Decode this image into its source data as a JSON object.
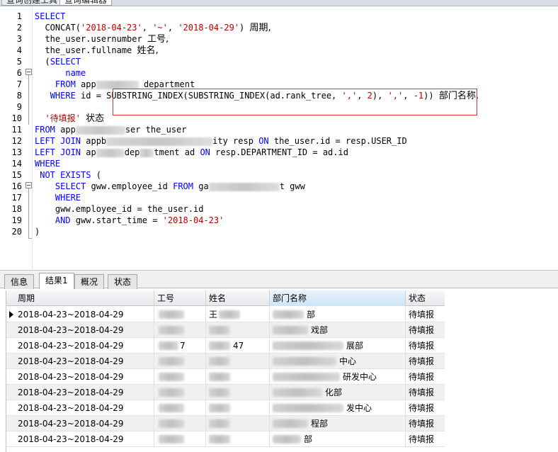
{
  "top_tabs": [
    "查询创建工具",
    "查询编辑器"
  ],
  "code": {
    "lines": [
      {
        "n": "1",
        "parts": [
          [
            "kw",
            "SELECT"
          ]
        ]
      },
      {
        "n": "2",
        "parts": [
          [
            "pl",
            "  CONCAT("
          ],
          [
            "str",
            "'2018-04-23'"
          ],
          [
            "pl",
            ", "
          ],
          [
            "str",
            "'~'"
          ],
          [
            "pl",
            ", "
          ],
          [
            "str",
            "'2018-04-29'"
          ],
          [
            "pl",
            ") "
          ],
          [
            "cjk",
            "周期,"
          ]
        ]
      },
      {
        "n": "3",
        "parts": [
          [
            "pl",
            "  the_user.usernumber "
          ],
          [
            "cjk",
            "工号,"
          ]
        ]
      },
      {
        "n": "4",
        "parts": [
          [
            "pl",
            "  the_user.fullname "
          ],
          [
            "cjk",
            "姓名,"
          ]
        ]
      },
      {
        "n": "5",
        "parts": [
          [
            "pl",
            "  ("
          ],
          [
            "kw",
            "SELECT"
          ]
        ]
      },
      {
        "n": "6",
        "parts": [
          [
            "pl",
            "      "
          ],
          [
            "kw",
            "name"
          ]
        ]
      },
      {
        "n": "7",
        "parts": [
          [
            "pl",
            "    "
          ],
          [
            "kw",
            "FROM"
          ],
          [
            "pl",
            " app"
          ],
          [
            "blur",
            "60"
          ],
          [
            "pl",
            " department"
          ]
        ]
      },
      {
        "n": "8",
        "parts": [
          [
            "pl",
            "   "
          ],
          [
            "kw",
            "WHERE"
          ],
          [
            "pl",
            " id = SUBSTRING_INDEX(SUBSTRING_INDEX(ad.rank_tree, "
          ],
          [
            "str",
            "','"
          ],
          [
            "pl",
            ", "
          ],
          [
            "num",
            "2"
          ],
          [
            "pl",
            "), "
          ],
          [
            "str",
            "','"
          ],
          [
            "pl",
            ", "
          ],
          [
            "num",
            "-1"
          ],
          [
            "pl",
            ")) "
          ],
          [
            "cjk",
            "部门名称,"
          ]
        ]
      },
      {
        "n": "9",
        "parts": []
      },
      {
        "n": "10",
        "parts": [
          [
            "pl",
            "  "
          ],
          [
            "str",
            "'待填报'"
          ],
          [
            "pl",
            " "
          ],
          [
            "cjk",
            "状态"
          ]
        ]
      },
      {
        "n": "11",
        "parts": [
          [
            "kw",
            "FROM"
          ],
          [
            "pl",
            " app"
          ],
          [
            "blur",
            "70"
          ],
          [
            "pl",
            "ser the_user"
          ]
        ]
      },
      {
        "n": "12",
        "parts": [
          [
            "kw",
            "LEFT JOIN"
          ],
          [
            "pl",
            " appb"
          ],
          [
            "blur",
            "150"
          ],
          [
            "pl",
            "ity resp "
          ],
          [
            "kw",
            "ON"
          ],
          [
            "pl",
            " the_user.id = resp.USER_ID"
          ]
        ]
      },
      {
        "n": "13",
        "parts": [
          [
            "kw",
            "LEFT JOIN"
          ],
          [
            "pl",
            " ap"
          ],
          [
            "blur",
            "40"
          ],
          [
            "pl",
            "dep"
          ],
          [
            "blur",
            "20"
          ],
          [
            "pl",
            "tment ad "
          ],
          [
            "kw",
            "ON"
          ],
          [
            "pl",
            " resp.DEPARTMENT_ID = ad.id"
          ]
        ]
      },
      {
        "n": "14",
        "parts": [
          [
            "kw",
            "WHERE"
          ]
        ]
      },
      {
        "n": "15",
        "parts": [
          [
            "pl",
            " "
          ],
          [
            "kw",
            "NOT EXISTS"
          ],
          [
            "pl",
            " ("
          ]
        ]
      },
      {
        "n": "16",
        "parts": [
          [
            "pl",
            "    "
          ],
          [
            "kw",
            "SELECT"
          ],
          [
            "pl",
            " gww.employee_id "
          ],
          [
            "kw",
            "FROM"
          ],
          [
            "pl",
            " ga"
          ],
          [
            "blur",
            "100"
          ],
          [
            "pl",
            "t gww"
          ]
        ]
      },
      {
        "n": "17",
        "parts": [
          [
            "pl",
            "    "
          ],
          [
            "kw",
            "WHERE"
          ]
        ]
      },
      {
        "n": "18",
        "parts": [
          [
            "pl",
            "    gww.employee_id = the_user.id"
          ]
        ]
      },
      {
        "n": "19",
        "parts": [
          [
            "pl",
            "    "
          ],
          [
            "kw",
            "AND"
          ],
          [
            "pl",
            " gww.start_time = "
          ],
          [
            "str",
            "'2018-04-23'"
          ]
        ]
      },
      {
        "n": "20",
        "parts": [
          [
            "pl",
            ")"
          ]
        ]
      }
    ]
  },
  "result_tabs": [
    "信息",
    "结果1",
    "概况",
    "状态"
  ],
  "grid": {
    "headers": [
      "周期",
      "工号",
      "姓名",
      "部门名称",
      "状态"
    ],
    "rows": [
      {
        "period": "2018-04-23~2018-04-29",
        "num_vis": "",
        "name_vis": "王",
        "dept_vis": "部",
        "status": "待填报"
      },
      {
        "period": "2018-04-23~2018-04-29",
        "num_vis": "",
        "name_vis": "",
        "dept_vis": "戏部",
        "status": "待填报"
      },
      {
        "period": "2018-04-23~2018-04-29",
        "num_vis": "7",
        "name_vis": "47",
        "dept_vis": "展部",
        "status": "待填报"
      },
      {
        "period": "2018-04-23~2018-04-29",
        "num_vis": "",
        "name_vis": "",
        "dept_vis": "中心",
        "status": "待填报"
      },
      {
        "period": "2018-04-23~2018-04-29",
        "num_vis": "",
        "name_vis": "",
        "dept_vis": "研发中心",
        "status": "待填报"
      },
      {
        "period": "2018-04-23~2018-04-29",
        "num_vis": "",
        "name_vis": "",
        "dept_vis": "化部",
        "status": "待填报"
      },
      {
        "period": "2018-04-23~2018-04-29",
        "num_vis": "",
        "name_vis": "",
        "dept_vis": "发中心",
        "status": "待填报"
      },
      {
        "period": "2018-04-23~2018-04-29",
        "num_vis": "",
        "name_vis": "",
        "dept_vis": "程部",
        "status": "待填报"
      },
      {
        "period": "2018-04-23~2018-04-29",
        "num_vis": "",
        "name_vis": "",
        "dept_vis": "部",
        "status": "待填报"
      }
    ]
  }
}
